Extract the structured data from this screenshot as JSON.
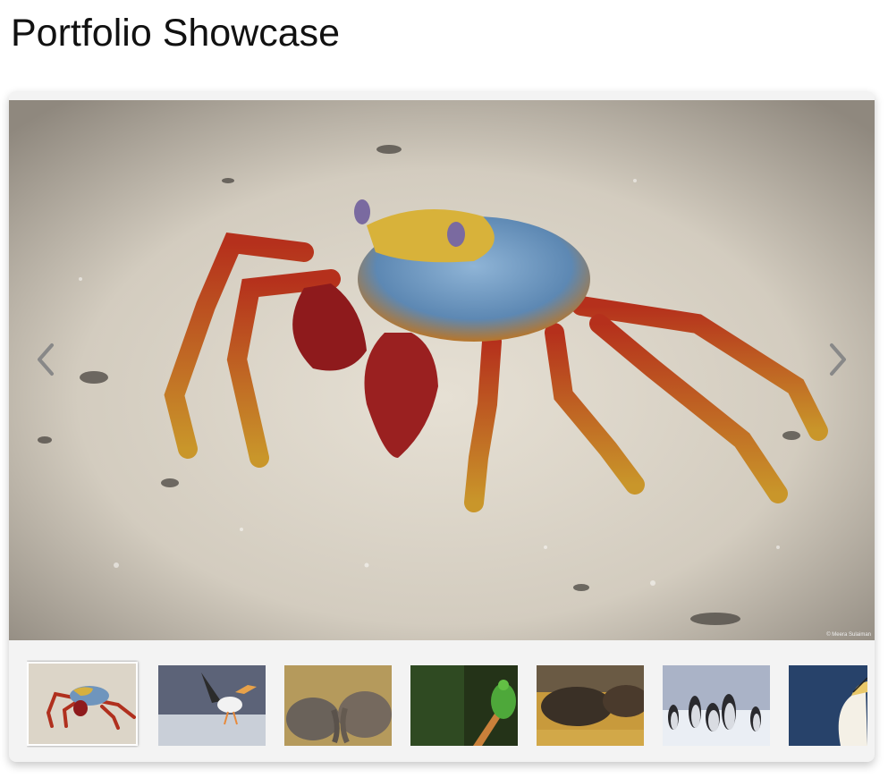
{
  "page": {
    "title": "Portfolio Showcase"
  },
  "gallery": {
    "credit": "© Meera Sulaiman",
    "prev_icon": "chevron-left-icon",
    "next_icon": "chevron-right-icon",
    "active_index": 0,
    "thumbnails": [
      {
        "subject": "crab"
      },
      {
        "subject": "pelican"
      },
      {
        "subject": "elephants"
      },
      {
        "subject": "frog"
      },
      {
        "subject": "bison"
      },
      {
        "subject": "penguins"
      },
      {
        "subject": "gannet"
      }
    ]
  },
  "colors": {
    "accent_red": "#a8261a",
    "sand": "#d9d2c4",
    "frame_bg": "#f3f3f3"
  }
}
